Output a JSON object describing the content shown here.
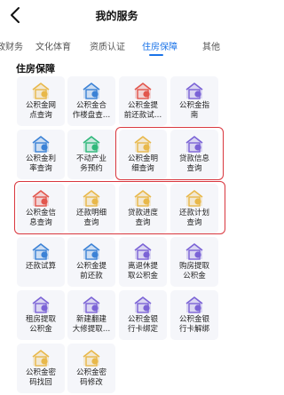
{
  "header": {
    "title": "我的服务"
  },
  "tabs": [
    {
      "label": "政财务"
    },
    {
      "label": "文化体育"
    },
    {
      "label": "资质认证"
    },
    {
      "label": "住房保障"
    },
    {
      "label": "其他"
    }
  ],
  "active_tab": "住房保障",
  "section": {
    "title": "住房保障"
  },
  "services": [
    {
      "label1": "公积金网",
      "label2": "点查询",
      "icon": "house-location-icon",
      "color": "#e8b84a"
    },
    {
      "label1": "公积金合",
      "label2": "作楼盘查…",
      "icon": "house-building-icon",
      "color": "#3b82d6"
    },
    {
      "label1": "公积金提",
      "label2": "前还款试…",
      "icon": "house-repay-icon",
      "color": "#e2564d"
    },
    {
      "label1": "公积金指",
      "label2": "南",
      "icon": "house-guide-icon",
      "color": "#7b63d6"
    },
    {
      "label1": "公积金利",
      "label2": "率查询",
      "icon": "house-rate-icon",
      "color": "#3b82d6"
    },
    {
      "label1": "不动产业",
      "label2": "务预约",
      "icon": "building-icon",
      "color": "#2fb87a"
    },
    {
      "label1": "公积金明",
      "label2": "细查询",
      "icon": "house-detail-icon",
      "color": "#e8b84a"
    },
    {
      "label1": "贷款信息",
      "label2": "查询",
      "icon": "loan-info-icon",
      "color": "#7b63d6"
    },
    {
      "label1": "公积金信",
      "label2": "息查询",
      "icon": "house-info-icon",
      "color": "#e2564d"
    },
    {
      "label1": "还款明细",
      "label2": "查询",
      "icon": "repay-detail-icon",
      "color": "#e8b84a"
    },
    {
      "label1": "贷款进度",
      "label2": "查询",
      "icon": "loan-progress-icon",
      "color": "#e8b84a"
    },
    {
      "label1": "还款计划",
      "label2": "查询",
      "icon": "repay-plan-icon",
      "color": "#e8b84a"
    },
    {
      "label1": "还款试算",
      "label2": "",
      "icon": "calculator-icon",
      "color": "#3b82d6"
    },
    {
      "label1": "公积金提",
      "label2": "前还款",
      "icon": "house-prepay-icon",
      "color": "#3b82d6"
    },
    {
      "label1": "离退休提",
      "label2": "取公积金",
      "icon": "retire-icon",
      "color": "#7b63d6"
    },
    {
      "label1": "购房提取",
      "label2": "公积金",
      "icon": "house-buy-icon",
      "color": "#7b63d6"
    },
    {
      "label1": "租房提取",
      "label2": "公积金",
      "icon": "rent-icon",
      "color": "#7b63d6"
    },
    {
      "label1": "新建翻建",
      "label2": "大修提取…",
      "icon": "house-build-icon",
      "color": "#7b63d6"
    },
    {
      "label1": "公积金银",
      "label2": "行卡绑定",
      "icon": "card-bind-icon",
      "color": "#7b63d6"
    },
    {
      "label1": "公积金银",
      "label2": "行卡解绑",
      "icon": "card-unbind-icon",
      "color": "#7b63d6"
    },
    {
      "label1": "公积金密",
      "label2": "码找回",
      "icon": "key-recover-icon",
      "color": "#e8b84a"
    },
    {
      "label1": "公积金密",
      "label2": "码修改",
      "icon": "key-edit-icon",
      "color": "#e8b84a"
    }
  ]
}
